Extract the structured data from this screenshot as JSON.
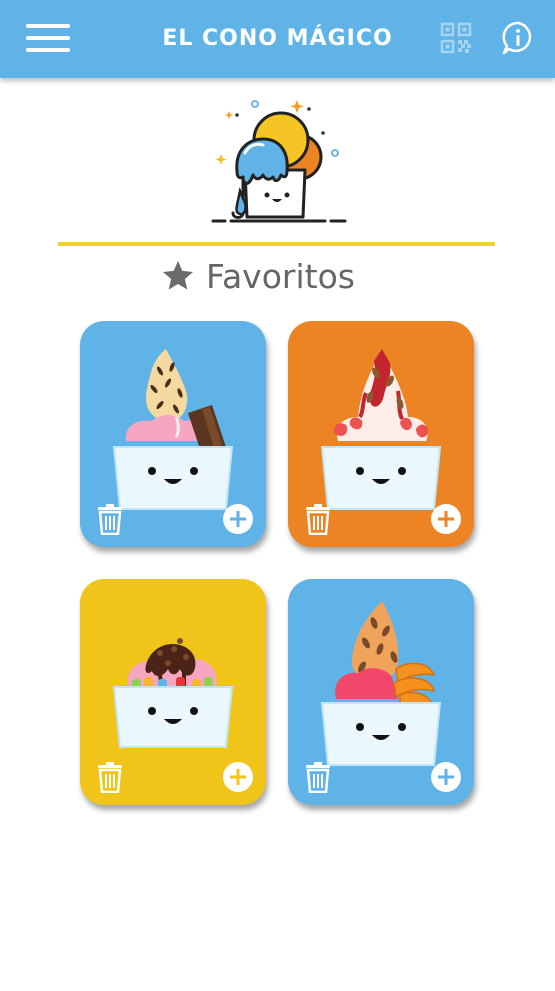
{
  "header": {
    "title": "EL CONO MÁGICO",
    "menu_icon": "hamburger-menu-icon",
    "qr_icon": "qr-code-icon",
    "info_icon": "info-icon",
    "background_color": "#5fb3e6"
  },
  "favorites": {
    "title": "Favoritos",
    "icon": "star-icon",
    "divider_color": "#f1d22a"
  },
  "cards": [
    {
      "background_color": "#5fb3e6",
      "topping": "chocolate-chip-waffle",
      "delete_icon": "trash-icon",
      "add_icon": "plus-circle-icon"
    },
    {
      "background_color": "#ec8423",
      "topping": "strawberry-sauce",
      "delete_icon": "trash-icon",
      "add_icon": "plus-circle-icon"
    },
    {
      "background_color": "#f0c419",
      "topping": "chocolate-gummy-bears",
      "delete_icon": "trash-icon",
      "add_icon": "plus-circle-icon"
    },
    {
      "background_color": "#5fb3e6",
      "topping": "mango-almond",
      "delete_icon": "trash-icon",
      "add_icon": "plus-circle-icon"
    }
  ]
}
